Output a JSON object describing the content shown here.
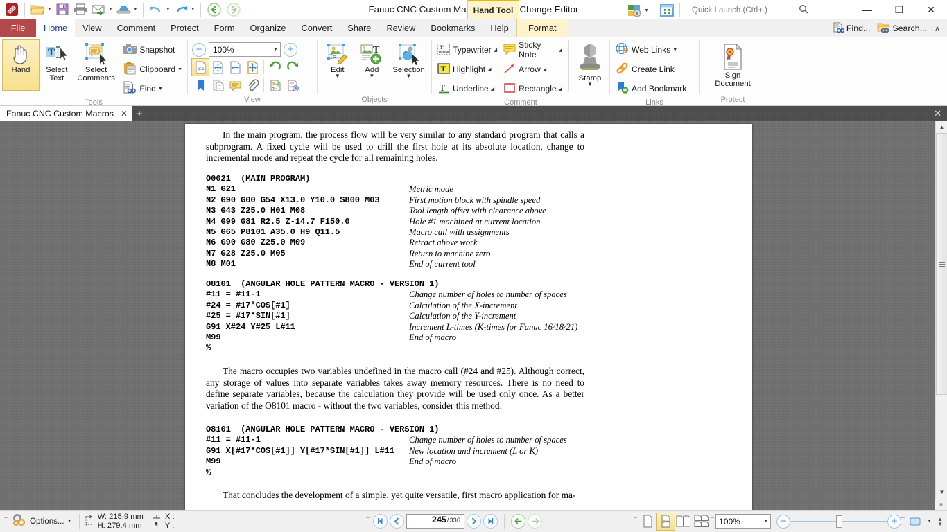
{
  "window": {
    "title": "Fanuc CNC Custom Macros - PDF-XChange Editor",
    "context_tool": "Hand Tool",
    "minimize": "—",
    "restore": "❐",
    "close": "✕"
  },
  "quick_access": {
    "items": [
      {
        "name": "app-logo-icon",
        "label": ""
      },
      {
        "name": "open-icon",
        "label": ""
      },
      {
        "name": "save-icon",
        "label": ""
      },
      {
        "name": "print-icon",
        "label": ""
      },
      {
        "name": "email-icon",
        "label": ""
      },
      {
        "name": "scan-icon",
        "label": ""
      },
      {
        "name": "undo-icon",
        "label": ""
      },
      {
        "name": "redo-icon",
        "label": ""
      },
      {
        "name": "back-icon",
        "label": ""
      },
      {
        "name": "forward-icon",
        "label": ""
      }
    ]
  },
  "search": {
    "placeholder": "Quick Launch (Ctrl+.)",
    "value": ""
  },
  "tabs": {
    "file": "File",
    "items": [
      {
        "label": "Home",
        "active": true
      },
      {
        "label": "View",
        "active": false
      },
      {
        "label": "Comment",
        "active": false
      },
      {
        "label": "Protect",
        "active": false
      },
      {
        "label": "Form",
        "active": false
      },
      {
        "label": "Organize",
        "active": false
      },
      {
        "label": "Convert",
        "active": false
      },
      {
        "label": "Share",
        "active": false
      },
      {
        "label": "Review",
        "active": false
      },
      {
        "label": "Bookmarks",
        "active": false
      },
      {
        "label": "Help",
        "active": false
      }
    ],
    "context_tab": "Format",
    "right_items": [
      {
        "label": "Find...",
        "icon": "find-icon"
      },
      {
        "label": "Search...",
        "icon": "search-folder-icon"
      }
    ],
    "collapse": "∧"
  },
  "ribbon": {
    "groups": [
      {
        "label": "Tools",
        "big_buttons": [
          {
            "label": "Hand",
            "selected": true,
            "icon": "hand-icon"
          },
          {
            "label": "Select\nText",
            "selected": false,
            "icon": "select-text-icon"
          },
          {
            "label": "Select\nComments",
            "selected": false,
            "icon": "select-comments-icon"
          }
        ],
        "small_buttons": [
          {
            "label": "Snapshot",
            "icon": "camera-icon",
            "caret": false
          },
          {
            "label": "Clipboard",
            "icon": "clipboard-icon",
            "caret": true
          },
          {
            "label": "Find",
            "icon": "find-icon",
            "caret": true
          }
        ]
      },
      {
        "label": "View",
        "zoom_value": "100%",
        "zoom_out": "−",
        "zoom_in": "+",
        "icons_row1": [
          "actual-size-icon",
          "fit-page-icon",
          "fit-width-icon",
          "fit-visible-icon",
          "rotate-left-icon",
          "rotate-right-icon"
        ],
        "icons_row2": [
          "bookmarks-pane-icon",
          "thumbnails-pane-icon",
          "comments-pane-icon",
          "attachments-pane-icon",
          "content-pane-icon",
          "properties-icon"
        ]
      },
      {
        "label": "Objects",
        "big_buttons": [
          {
            "label": "Edit",
            "icon": "edit-object-icon",
            "caret": true
          },
          {
            "label": "Add",
            "icon": "add-object-icon",
            "caret": true
          },
          {
            "label": "Selection",
            "icon": "selection-icon",
            "caret": true
          }
        ]
      },
      {
        "label": "Comment",
        "small_buttons": [
          {
            "label": "Typewriter",
            "icon": "typewriter-icon",
            "caret": true
          },
          {
            "label": "Sticky Note",
            "icon": "sticky-note-icon",
            "caret": true
          },
          {
            "label": "Highlight",
            "icon": "highlight-icon",
            "caret": true
          },
          {
            "label": "Arrow",
            "icon": "arrow-icon",
            "caret": true
          },
          {
            "label": "Underline",
            "icon": "underline-icon",
            "caret": true
          },
          {
            "label": "Rectangle",
            "icon": "rectangle-icon",
            "caret": true
          }
        ],
        "stamp": {
          "label": "Stamp",
          "icon": "stamp-icon",
          "caret": true
        }
      },
      {
        "label": "Links",
        "small_buttons": [
          {
            "label": "Web Links",
            "icon": "web-links-icon",
            "caret": true
          },
          {
            "label": "Create Link",
            "icon": "create-link-icon",
            "caret": false
          },
          {
            "label": "Add Bookmark",
            "icon": "add-bookmark-icon",
            "caret": false
          }
        ]
      },
      {
        "label": "Protect",
        "big_buttons": [
          {
            "label": "Sign\nDocument",
            "icon": "sign-document-icon",
            "caret": false
          }
        ]
      }
    ]
  },
  "document_tabs": {
    "items": [
      {
        "label": "Fanuc CNC Custom Macros",
        "close": "✕"
      }
    ],
    "new_tab": "+",
    "close_all": "✕"
  },
  "page_content": {
    "para1": "In the main program, the process flow will be very similar to any standard program that calls a subprogram. A fixed cycle will be used to drill the first hole at its absolute location, change to incremental mode and repeat the cycle for all remaining holes.",
    "block1": [
      {
        "code": "O0021  (MAIN PROGRAM)",
        "comment": ""
      },
      {
        "code": "N1 G21",
        "comment": "Metric mode"
      },
      {
        "code": "N2 G90 G00 G54 X13.0 Y10.0 S800 M03",
        "comment": "First motion block with spindle speed"
      },
      {
        "code": "N3 G43 Z25.0 H01 M08",
        "comment": "Tool length offset with clearance above"
      },
      {
        "code": "N4 G99 G81 R2.5 Z-14.7 F150.0",
        "comment": "Hole #1 machined at current location"
      },
      {
        "code": "N5 G65 P8101 A35.0 H9 Q11.5",
        "comment": "Macro call with assignments"
      },
      {
        "code": "N6 G90 G80 Z25.0 M09",
        "comment": "Retract above work"
      },
      {
        "code": "N7 G28 Z25.0 M05",
        "comment": "Return to machine zero"
      },
      {
        "code": "N8 M01",
        "comment": "End of current tool"
      }
    ],
    "block2": [
      {
        "code": "O8101  (ANGULAR HOLE PATTERN MACRO - VERSION 1)",
        "comment": ""
      },
      {
        "code": "#11 = #11-1",
        "comment": "Change number of holes to number of spaces"
      },
      {
        "code": "#24 = #17*COS[#1]",
        "comment": "Calculation of the X-increment"
      },
      {
        "code": "#25 = #17*SIN[#1]",
        "comment": "Calculation of the Y-increment"
      },
      {
        "code": "G91 X#24 Y#25 L#11",
        "comment": "Increment L-times (K-times for Fanuc 16/18/21)"
      },
      {
        "code": "M99",
        "comment": "End of macro"
      },
      {
        "code": "%",
        "comment": ""
      }
    ],
    "para2": "The macro occupies two variables undefined in the macro call (#24 and #25). Although correct, any storage of values into separate variables takes away memory resources. There is no need to define separate variables, because the calculation they provide will be used only once. As a better variation of the O8101 macro - without the two variables, consider this method:",
    "block3": [
      {
        "code": "O8101  (ANGULAR HOLE PATTERN MACRO - VERSION 1)",
        "comment": ""
      },
      {
        "code": "#11 = #11-1",
        "comment": "Change number of holes to number of spaces"
      },
      {
        "code": "G91 X[#17*COS[#1]] Y[#17*SIN[#1]] L#11",
        "comment": "New location and increment (L or K)"
      },
      {
        "code": "M99",
        "comment": "End of macro"
      },
      {
        "code": "%",
        "comment": ""
      }
    ],
    "para3": "That concludes the development of a simple, yet quite versatile, first macro application for ma-"
  },
  "status_bar": {
    "options_label": "Options...",
    "width_label": "W: 215.9 mm",
    "height_label": "H: 279.4 mm",
    "x_label": "X :",
    "y_label": "Y :",
    "page_current": "245",
    "page_total": "336",
    "page_separator": "/",
    "nav_first": "⏮",
    "nav_prev": "‹",
    "nav_next": "›",
    "nav_last": "⏭",
    "nav_back": "←",
    "nav_forward": "→",
    "zoom_value": "100%",
    "zoom_out": "−",
    "zoom_in": "+",
    "layout_modes": [
      "single-page-icon",
      "single-page-continuous-icon",
      "two-pages-icon",
      "two-pages-continuous-icon"
    ],
    "selected_layout": 1
  },
  "colors": {
    "accent_blue": "#2e86c8",
    "file_tab_red": "#b4494d",
    "context_yellow": "#fdf3cd",
    "selection_gold": "#f8e08e",
    "doc_bg_gray": "#6e6e6e"
  }
}
